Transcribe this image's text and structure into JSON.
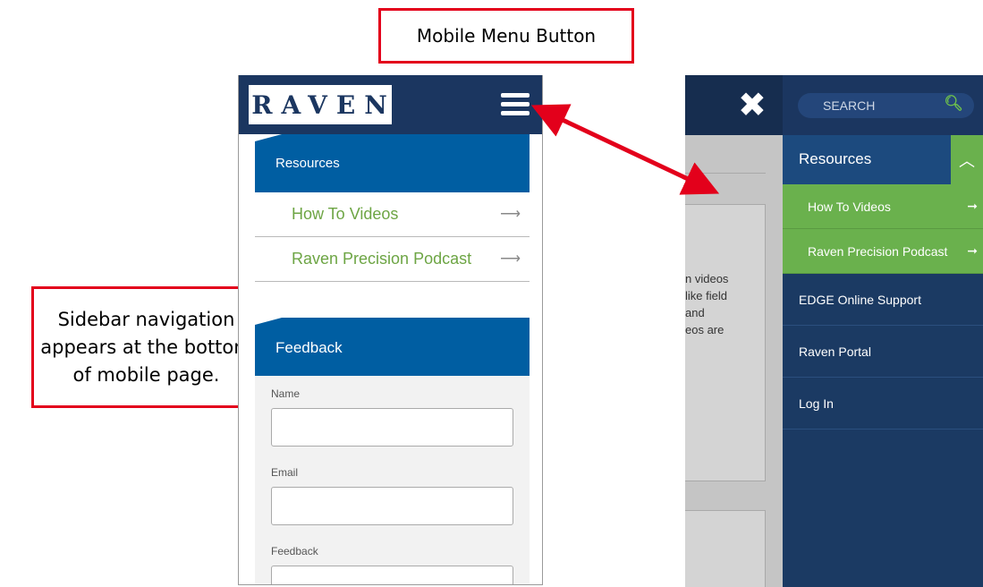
{
  "callouts": {
    "menu_button": "Mobile Menu Button",
    "sidebar_nav": "Sidebar navigation appears at the bottom of mobile page."
  },
  "mobile": {
    "logo": "RAVEN",
    "resources": {
      "heading": "Resources",
      "links": [
        "How To Videos",
        "Raven Precision Podcast"
      ]
    },
    "feedback": {
      "heading": "Feedback",
      "fields": [
        "Name",
        "Email",
        "Feedback"
      ]
    }
  },
  "menu": {
    "search_placeholder": "SEARCH",
    "resources_heading": "Resources",
    "sub_items": [
      "How To Videos",
      "Raven Precision Podcast"
    ],
    "items": [
      "EDGE Online Support",
      "Raven Portal",
      "Log In"
    ],
    "background_text": [
      "n videos",
      "like field",
      "and",
      "eos are"
    ]
  },
  "colors": {
    "navy": "#1b3660",
    "blue": "#005ea2",
    "green": "#6ab14d",
    "callout_red": "#e3001b"
  },
  "icons": [
    "hamburger-icon",
    "close-icon",
    "search-icon",
    "chevron-up-icon",
    "arrow-right-icon"
  ]
}
